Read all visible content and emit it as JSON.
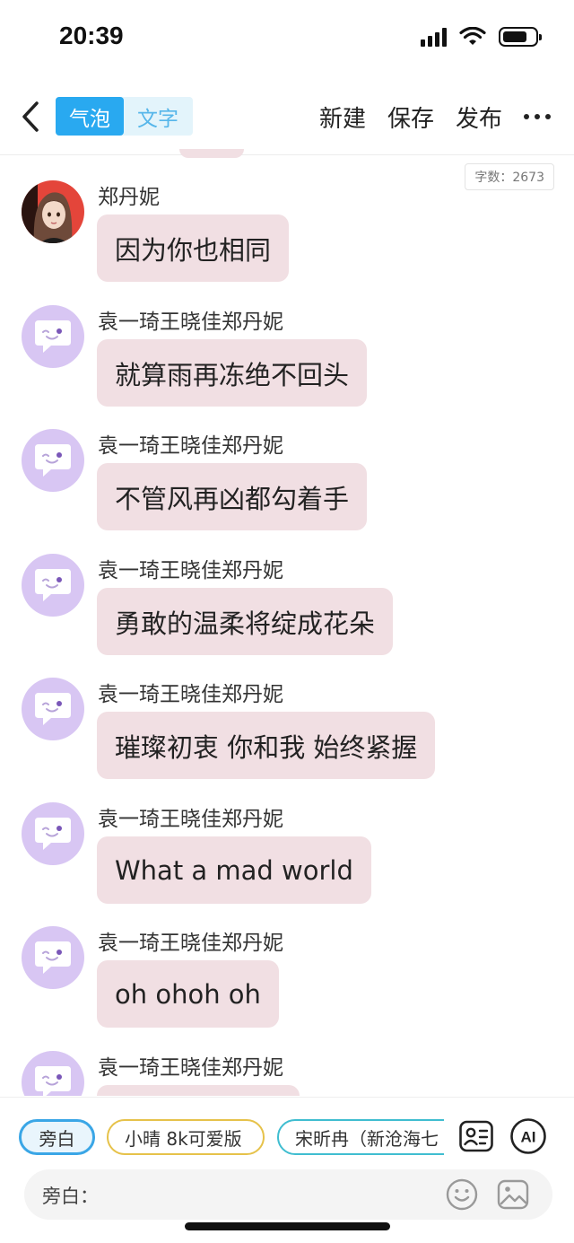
{
  "status_bar": {
    "time": "20:39",
    "battery_level": 0.75
  },
  "nav": {
    "back_icon": "chevron-left-icon",
    "modes": [
      {
        "label": "气泡",
        "active": true
      },
      {
        "label": "文字",
        "active": false
      }
    ],
    "actions": [
      {
        "label": "新建"
      },
      {
        "label": "保存"
      },
      {
        "label": "发布"
      }
    ],
    "more_icon": "more-dots-icon"
  },
  "word_count": "字数：2673",
  "messages": [
    {
      "speaker": "郑丹妮",
      "text": "因为你也相同",
      "avatar": "photo"
    },
    {
      "speaker": "袁一琦王晓佳郑丹妮",
      "text": "就算雨再冻绝不回头",
      "avatar": "bot"
    },
    {
      "speaker": "袁一琦王晓佳郑丹妮",
      "text": "不管风再凶都勾着手",
      "avatar": "bot"
    },
    {
      "speaker": "袁一琦王晓佳郑丹妮",
      "text": "勇敢的温柔将绽成花朵",
      "avatar": "bot"
    },
    {
      "speaker": "袁一琦王晓佳郑丹妮",
      "text": "璀璨初衷 你和我 始终紧握",
      "avatar": "bot"
    },
    {
      "speaker": "袁一琦王晓佳郑丹妮",
      "text": "What a mad world",
      "avatar": "bot"
    },
    {
      "speaker": "袁一琦王晓佳郑丹妮",
      "text": "oh ohoh oh",
      "avatar": "bot"
    },
    {
      "speaker": "袁一琦王晓佳郑丹妮",
      "text": "",
      "avatar": "bot"
    }
  ],
  "bottom": {
    "chips": [
      {
        "label": "旁白"
      },
      {
        "label": "小晴 8k可爱版"
      },
      {
        "label": "宋昕冉（新沧海七"
      }
    ],
    "contact_icon": "contact-card-icon",
    "ai_label": "AI",
    "input_label": "旁白：",
    "emoji_icon": "smile-icon",
    "image_icon": "image-icon"
  },
  "colors": {
    "accent": "#29a9f0",
    "bubble": "#f1dfe3",
    "avatar_bot": "#d8c6f3"
  }
}
